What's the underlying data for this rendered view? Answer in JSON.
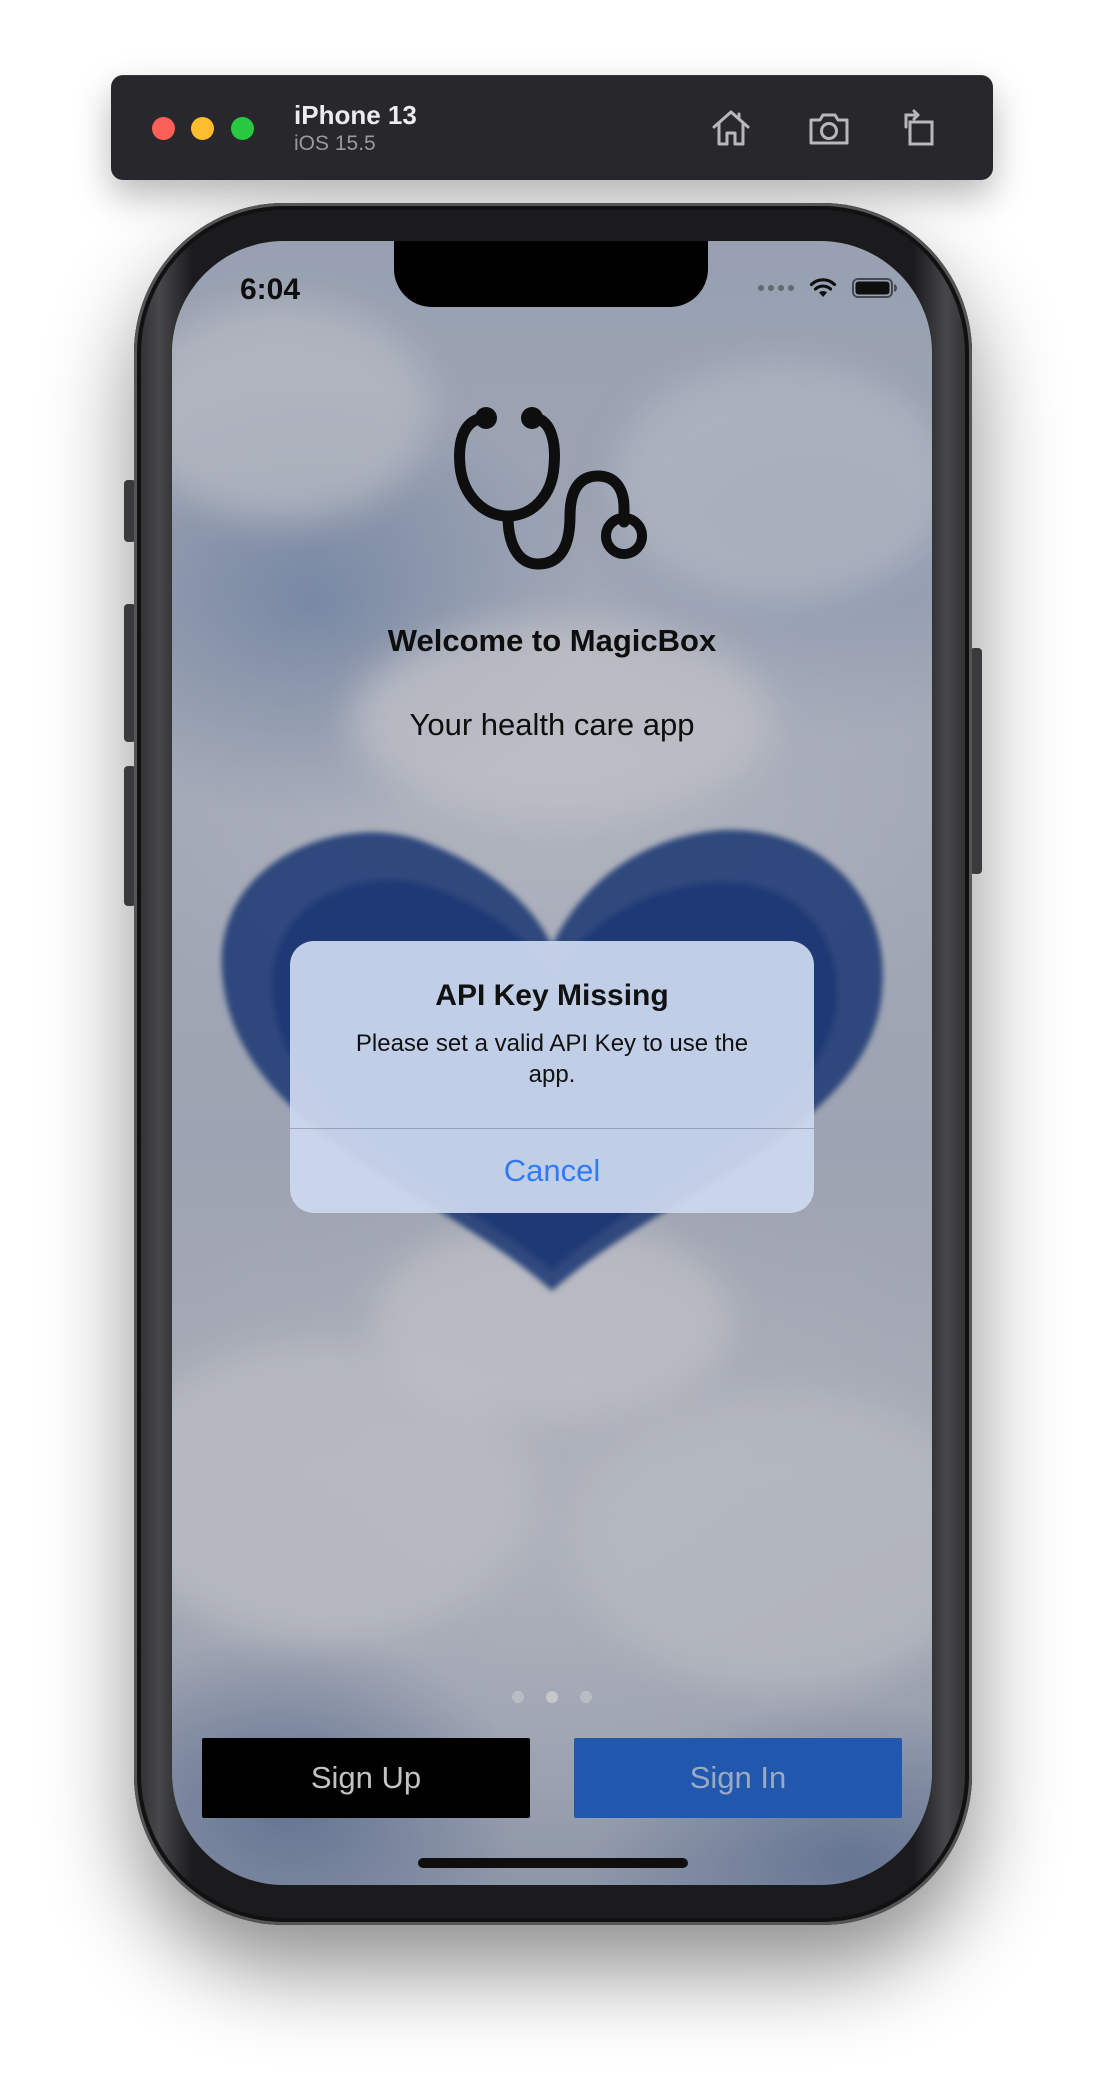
{
  "simulator": {
    "device_name": "iPhone 13",
    "os_version": "iOS 15.5",
    "toolbar_icons": [
      "home-icon",
      "screenshot-icon",
      "rotate-icon"
    ]
  },
  "status_bar": {
    "time": "6:04",
    "icons": [
      "cellular-signal-icon",
      "wifi-icon",
      "battery-icon"
    ]
  },
  "welcome": {
    "icon": "stethoscope-icon",
    "title": "Welcome to MagicBox",
    "subtitle": "Your health care app"
  },
  "pager": {
    "page_count": 3,
    "current_page": 2
  },
  "buttons": {
    "sign_up": "Sign Up",
    "sign_in": "Sign In"
  },
  "alert": {
    "title": "API Key Missing",
    "message": "Please set a valid API Key to use the app.",
    "cancel_label": "Cancel"
  },
  "colors": {
    "sign_in_button": "#2868cf",
    "sign_up_button": "#000000",
    "alert_action": "#2f7bf4",
    "alert_background": "#ccd8ee"
  }
}
